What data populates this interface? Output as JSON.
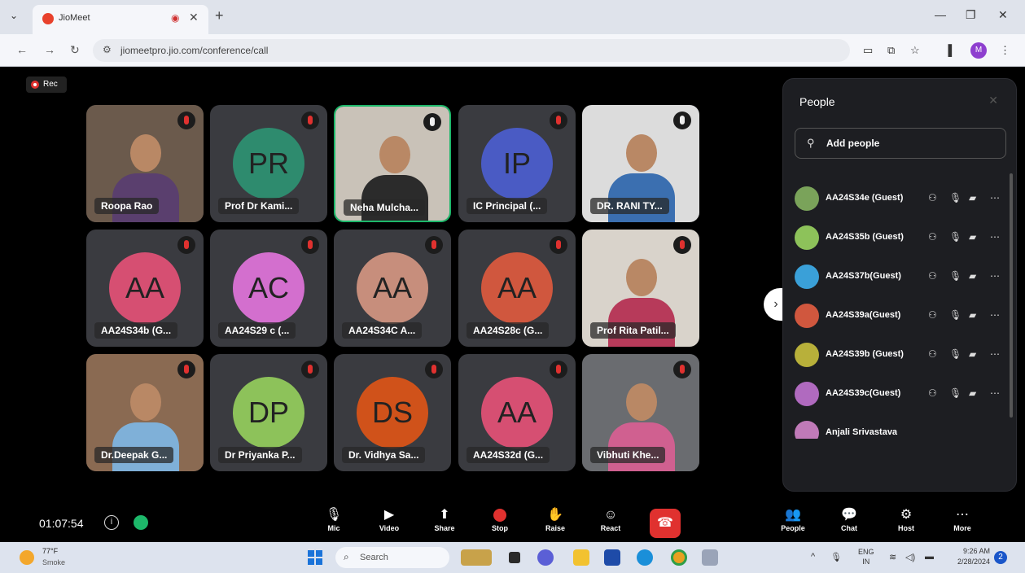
{
  "browser": {
    "tab_title": "JioMeet",
    "url": "jiomeetpro.jio.com/conference/call",
    "profile_initial": "M"
  },
  "meeting": {
    "rec_label": "Rec",
    "timer": "01:07:54",
    "tiles": [
      {
        "name": "Roopa Rao",
        "type": "video",
        "mic": "off",
        "bg": "#6b5a4c",
        "shirt": "#5a3f6e"
      },
      {
        "name": "Prof Dr Kami...",
        "type": "avatar",
        "initials": "PR",
        "color": "#2e8b6e",
        "mic": "off"
      },
      {
        "name": "Neha Mulcha...",
        "type": "video",
        "mic": "on",
        "active": true,
        "bg": "#c9c2b8",
        "shirt": "#2b2b2b"
      },
      {
        "name": "IC Principal (...",
        "type": "avatar",
        "initials": "IP",
        "color": "#4a5bc4",
        "mic": "off"
      },
      {
        "name": "DR. RANI TY...",
        "type": "video",
        "mic": "on",
        "bg": "#dcdcdc",
        "shirt": "#3b6fb0"
      },
      {
        "name": "AA24S34b (G...",
        "type": "avatar",
        "initials": "AA",
        "color": "#d64f72",
        "mic": "off"
      },
      {
        "name": "AA24S29 c (...",
        "type": "avatar",
        "initials": "AC",
        "color": "#d36fce",
        "mic": "off"
      },
      {
        "name": "AA24S34C A...",
        "type": "avatar",
        "initials": "AA",
        "color": "#c78e7c",
        "mic": "off"
      },
      {
        "name": "AA24S28c (G...",
        "type": "avatar",
        "initials": "AA",
        "color": "#d0573e",
        "mic": "off"
      },
      {
        "name": "Prof Rita Patil...",
        "type": "video",
        "mic": "off",
        "bg": "#d9d3cb",
        "shirt": "#b73a5a"
      },
      {
        "name": "Dr.Deepak G...",
        "type": "video",
        "mic": "off",
        "bg": "#8a6a52",
        "shirt": "#7fb0d8"
      },
      {
        "name": "Dr Priyanka P...",
        "type": "avatar",
        "initials": "DP",
        "color": "#8dc25a",
        "mic": "off"
      },
      {
        "name": "Dr. Vidhya Sa...",
        "type": "avatar",
        "initials": "DS",
        "color": "#d0521a",
        "mic": "off"
      },
      {
        "name": "AA24S32d (G...",
        "type": "avatar",
        "initials": "AA",
        "color": "#d64f72",
        "mic": "off"
      },
      {
        "name": "Vibhuti Khe...",
        "type": "video",
        "mic": "off",
        "bg": "#6a6c70",
        "shirt": "#d06090"
      }
    ],
    "controls": [
      {
        "label": "Mic",
        "icon": "mic-off-icon",
        "glyph": "🎙"
      },
      {
        "label": "Video",
        "icon": "video-icon",
        "glyph": "▶"
      },
      {
        "label": "Share",
        "icon": "share-icon",
        "glyph": "⬆"
      },
      {
        "label": "Stop",
        "icon": "stop-record-icon",
        "glyph": ""
      },
      {
        "label": "Raise",
        "icon": "hand-icon",
        "glyph": "✋"
      },
      {
        "label": "React",
        "icon": "react-icon",
        "glyph": "☺"
      }
    ],
    "right_controls": [
      {
        "label": "People",
        "icon": "people-icon",
        "glyph": "👥"
      },
      {
        "label": "Chat",
        "icon": "chat-icon",
        "glyph": "💬"
      },
      {
        "label": "Host",
        "icon": "host-icon",
        "glyph": "⚙"
      },
      {
        "label": "More",
        "icon": "more-icon",
        "glyph": "⋯"
      }
    ]
  },
  "people_panel": {
    "title": "People",
    "add_label": "Add people",
    "participants": [
      {
        "name": "AA24S34e (Guest)",
        "color": "#7aa35a"
      },
      {
        "name": "AA24S35b (Guest)",
        "color": "#8dc25a"
      },
      {
        "name": "AA24S37b(Guest)",
        "color": "#3aa0d8"
      },
      {
        "name": "AA24S39a(Guest)",
        "color": "#d0573e"
      },
      {
        "name": "AA24S39b (Guest)",
        "color": "#b8b03a"
      },
      {
        "name": "AA24S39c(Guest)",
        "color": "#b06abf"
      },
      {
        "name": "Anjali Srivastava",
        "color": "#c07ab8"
      }
    ]
  },
  "taskbar": {
    "weather_temp": "77°F",
    "weather_desc": "Smoke",
    "search_placeholder": "Search",
    "lang_top": "ENG",
    "lang_bottom": "IN",
    "time": "9:26 AM",
    "date": "2/28/2024",
    "notif_count": "2"
  }
}
